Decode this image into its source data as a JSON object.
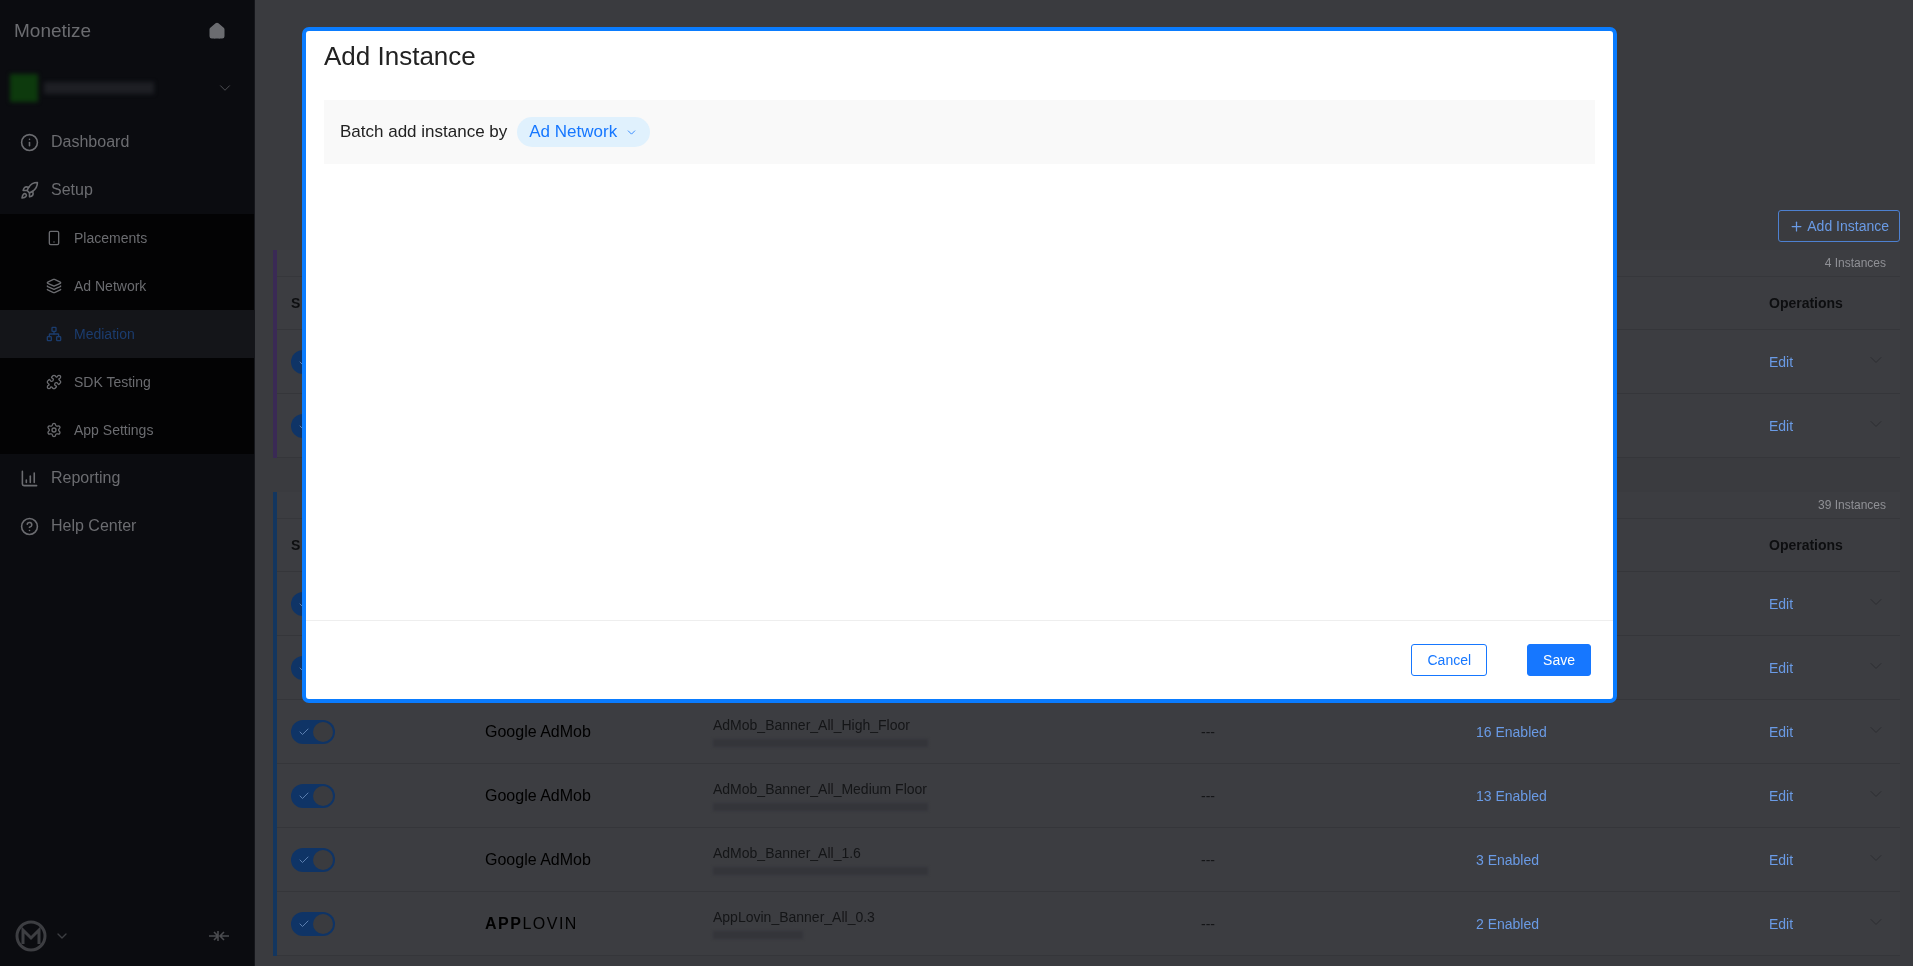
{
  "sidebar": {
    "title": "Monetize",
    "menu": [
      {
        "label": "Dashboard",
        "selected": false
      },
      {
        "label": "Setup",
        "selected": false,
        "expanded": true,
        "children": [
          {
            "label": "Placements",
            "selected": false
          },
          {
            "label": "Ad Network",
            "selected": false
          },
          {
            "label": "Mediation",
            "selected": true
          },
          {
            "label": "SDK Testing",
            "selected": false
          },
          {
            "label": "App Settings",
            "selected": false
          }
        ]
      },
      {
        "label": "Reporting",
        "selected": false
      },
      {
        "label": "Help Center",
        "selected": false
      }
    ]
  },
  "toolbar": {
    "add_button": "Add Instance"
  },
  "groups": [
    {
      "count": "4 Instances",
      "color": "#3a2a55",
      "columns": [
        "S",
        "Operations"
      ],
      "rows": [
        {
          "on": true,
          "edit": "Edit"
        },
        {
          "on": true,
          "edit": "Edit"
        }
      ]
    },
    {
      "count": "39 Instances",
      "color": "#13365f",
      "columns": [
        "S",
        "Operations"
      ],
      "rows": [
        {
          "on": true,
          "edit": "Edit"
        },
        {
          "on": true,
          "edit": "Edit"
        },
        {
          "on": true,
          "network": "Google AdMob",
          "name": "AdMob_Banner_All_High_Floor",
          "bid": "---",
          "status": "16 Enabled",
          "edit": "Edit"
        },
        {
          "on": true,
          "network": "Google AdMob",
          "name": "AdMob_Banner_All_Medium Floor",
          "bid": "---",
          "status": "13 Enabled",
          "edit": "Edit"
        },
        {
          "on": true,
          "network": "Google AdMob",
          "name": "AdMob_Banner_All_1.6",
          "bid": "---",
          "status": "3 Enabled",
          "edit": "Edit"
        },
        {
          "on": true,
          "network": "**APP**LOVIN",
          "name": "AppLovin_Banner_All_0.3",
          "bid": "---",
          "status": "2 Enabled",
          "edit": "Edit"
        }
      ]
    }
  ],
  "modal": {
    "title": "Add Instance",
    "batch_label": "Batch add instance by",
    "batch_value": "Ad Network",
    "buttons": [
      {
        "label": "Cancel",
        "kind": "secondary"
      },
      {
        "label": "Save",
        "kind": "primary"
      }
    ]
  }
}
